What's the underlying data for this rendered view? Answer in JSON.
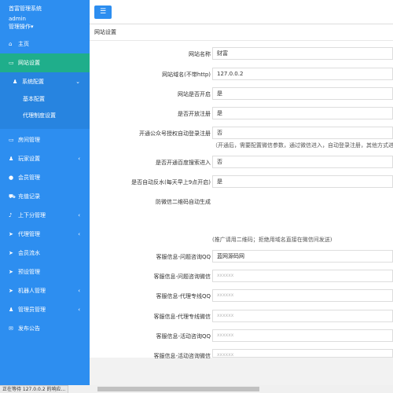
{
  "sidebar": {
    "title": "首富管理系统",
    "username": "admin",
    "user_menu": "管理操作",
    "items": [
      {
        "label": "主页",
        "icon": "home-icon"
      },
      {
        "label": "网站设置",
        "icon": "computer-icon"
      },
      {
        "label": "系统配置",
        "icon": "user-icon"
      },
      {
        "label": "基本配置"
      },
      {
        "label": "代理制度设置"
      },
      {
        "label": "房间管理",
        "icon": "computer-icon"
      },
      {
        "label": "玩家设置",
        "icon": "user-icon"
      },
      {
        "label": "会员管理",
        "icon": "person-icon"
      },
      {
        "label": "充值记录",
        "icon": "car-icon"
      },
      {
        "label": "上下分管理",
        "icon": "music-icon"
      },
      {
        "label": "代理管理",
        "icon": "send-icon"
      },
      {
        "label": "会员流水",
        "icon": "send-icon"
      },
      {
        "label": "预设管理",
        "icon": "send-icon"
      },
      {
        "label": "机器人管理",
        "icon": "send-icon"
      },
      {
        "label": "管理员管理",
        "icon": "user-icon"
      },
      {
        "label": "发布公告",
        "icon": "chat-icon"
      }
    ]
  },
  "topbar": {
    "menu_icon": "hamburger-icon"
  },
  "panel": {
    "title": "网站设置",
    "fields": [
      {
        "label": "网站名称",
        "value": "财富"
      },
      {
        "label": "网站域名(不带http)",
        "value": "127.0.0.2"
      },
      {
        "label": "网站是否开启",
        "value": "是"
      },
      {
        "label": "是否开放注册",
        "value": "是"
      },
      {
        "label": "开通公众号授权自动登录注册",
        "value": "否",
        "hint": "（开通后，需要配置微信参数，通过微信进入，自动登录注册，其他方式进入"
      },
      {
        "label": "是否开通百度搜索进入",
        "value": "否"
      },
      {
        "label": "是否自动反水(每天早上9点开启)",
        "value": "是"
      },
      {
        "label": "防微信二维码自动生成",
        "hint": "(推广请用二维码；拒绝用域名直接在微信间发送)"
      },
      {
        "label": "客服信息-问题咨询QQ",
        "value": "蓝网源码网"
      },
      {
        "label": "客服信息-问题咨询微信",
        "placeholder": "xxxxxx"
      },
      {
        "label": "客服信息-代理专线QQ",
        "placeholder": "xxxxxx"
      },
      {
        "label": "客服信息-代理专线微信",
        "placeholder": "xxxxxx"
      },
      {
        "label": "客服信息-活动咨询QQ",
        "placeholder": "xxxxxx"
      },
      {
        "label": "客服信息-活动咨询微信",
        "placeholder": "xxxxxx"
      }
    ]
  },
  "statusbar": {
    "text": "正在等待 127.0.0.2 的响应..."
  }
}
